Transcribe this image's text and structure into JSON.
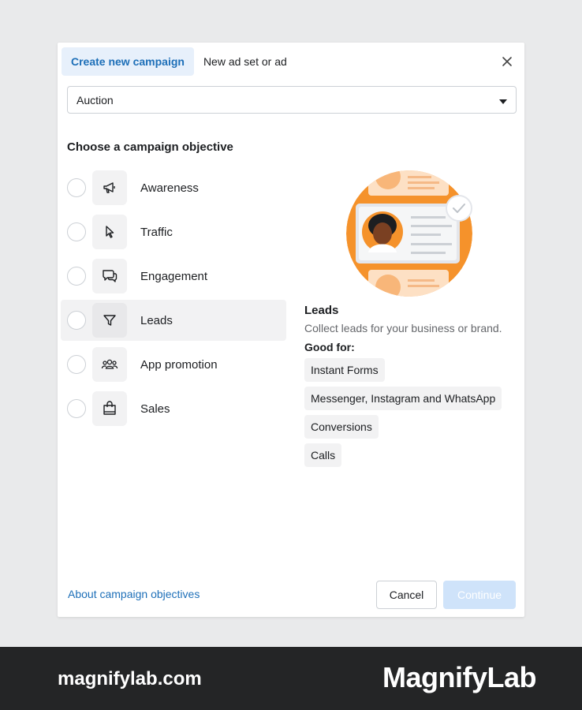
{
  "tabs": [
    {
      "label": "Create new campaign",
      "active": true
    },
    {
      "label": "New ad set or ad",
      "active": false
    }
  ],
  "buying_type": {
    "value": "Auction"
  },
  "heading": "Choose a campaign objective",
  "objectives": [
    {
      "label": "Awareness",
      "icon": "megaphone-icon"
    },
    {
      "label": "Traffic",
      "icon": "cursor-icon"
    },
    {
      "label": "Engagement",
      "icon": "chat-bubbles-icon"
    },
    {
      "label": "Leads",
      "icon": "funnel-icon",
      "selected": true
    },
    {
      "label": "App promotion",
      "icon": "people-icon"
    },
    {
      "label": "Sales",
      "icon": "shopping-bag-icon"
    }
  ],
  "detail": {
    "title": "Leads",
    "description": "Collect leads for your business or brand.",
    "good_for_label": "Good for:",
    "chips": [
      "Instant Forms",
      "Messenger, Instagram and WhatsApp",
      "Conversions",
      "Calls"
    ]
  },
  "footer": {
    "about_link": "About campaign objectives",
    "cancel": "Cancel",
    "continue": "Continue"
  },
  "branding": {
    "website": "magnifylab.com",
    "logo": "MagnifyLab"
  },
  "colors": {
    "accent": "#1d6fb8",
    "tab_active_bg": "#e7f0fb",
    "illustration_orange": "#f5922b",
    "continue_disabled": "#cfe3fa",
    "footer_bg": "#242526"
  }
}
